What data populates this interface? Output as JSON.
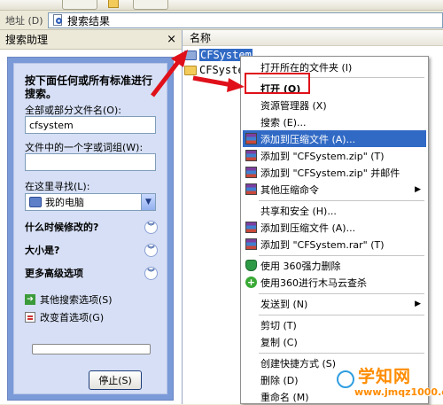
{
  "address_bar": {
    "label": "地址 (D)",
    "path": "搜索结果"
  },
  "search_pane": {
    "title": "搜索助理",
    "close_glyph": "×",
    "intro": "按下面任何或所有标准进行搜索。",
    "filename_label": "全部或部分文件名(O):",
    "filename_value": "cfsystem",
    "phrase_label": "文件中的一个字或词组(W):",
    "phrase_value": "",
    "look_in_label": "在这里寻找(L):",
    "look_in_value": "我的电脑",
    "sections": [
      {
        "label": "什么时候修改的?"
      },
      {
        "label": "大小是?"
      },
      {
        "label": "更多高级选项"
      }
    ],
    "links": [
      {
        "label": "其他搜索选项(S)"
      },
      {
        "label": "改变首选项(G)"
      }
    ],
    "stop_label": "停止(S)"
  },
  "results": {
    "column_name": "名称",
    "files": [
      {
        "name": "CFSystem",
        "selected": true
      },
      {
        "name": "CFSystem",
        "selected": false
      }
    ]
  },
  "context_menu": {
    "items": [
      {
        "label": "打开所在的文件夹 (I)"
      },
      {
        "label": "打开 (O)"
      },
      {
        "label": "资源管理器 (X)"
      },
      {
        "label": "搜索 (E)..."
      },
      {
        "label": "添加到压缩文件 (A)..."
      },
      {
        "label": "添加到 \"CFSystem.zip\" (T)"
      },
      {
        "label": "添加到 \"CFSystem.zip\" 并邮件"
      },
      {
        "label": "其他压缩命令"
      },
      {
        "label": "共享和安全 (H)..."
      },
      {
        "label": "添加到压缩文件 (A)..."
      },
      {
        "label": "添加到 \"CFSystem.rar\" (T)"
      },
      {
        "label": "使用 360强力删除"
      },
      {
        "label": "使用360进行木马云查杀"
      },
      {
        "label": "发送到 (N)"
      },
      {
        "label": "剪切 (T)"
      },
      {
        "label": "复制 (C)"
      },
      {
        "label": "创建快捷方式 (S)"
      },
      {
        "label": "删除 (D)"
      },
      {
        "label": "重命名 (M)"
      }
    ]
  },
  "colors": {
    "highlight": "#316ac5",
    "annotation_red": "#e0101a",
    "watermark_orange": "#ff8c00"
  },
  "watermark": {
    "logo": "学知网",
    "url": "www.jmqz1000.com"
  }
}
